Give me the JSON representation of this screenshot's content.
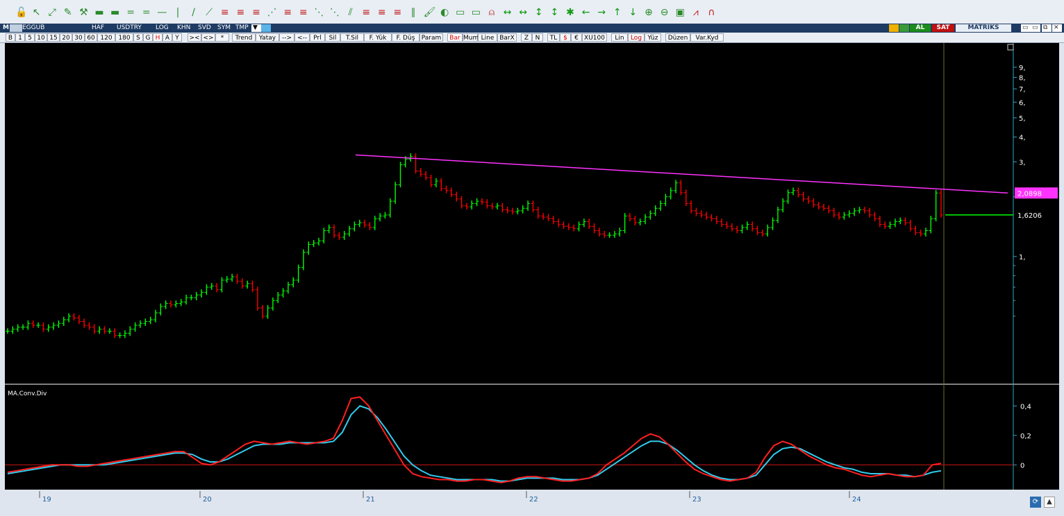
{
  "toolbar": {
    "icons": [
      "lock-icon",
      "cursor-icon",
      "resize-icon",
      "pencil-icon",
      "tools-icon",
      "ruler-icon",
      "ruler-icon",
      "equals-icon",
      "parallel-icon",
      "hline-icon",
      "vline-icon",
      "trendline-icon",
      "ray-icon",
      "fibo-icon",
      "fibo-icon",
      "fibo-icon",
      "fan-icon",
      "fibo-icon",
      "fibo-icon",
      "gann-icon",
      "gann-icon",
      "channel-icon",
      "fibo-icon",
      "fibo-icon",
      "fibo-icon",
      "lines-icon",
      "brush-icon",
      "paint-icon",
      "note-icon",
      "note-icon",
      "bell-icon",
      "arrows-h-icon",
      "arrows-h-icon",
      "arrows-v-icon",
      "arrows-v-icon",
      "star-icon",
      "arrow-left-icon",
      "arrow-right-icon",
      "arrow-up-icon",
      "arrow-down-icon",
      "zoom-in-icon",
      "zoom-out-icon",
      "box-icon",
      "chart-icon",
      "arch-icon"
    ]
  },
  "symbar": {
    "m": "M",
    "symbol": "EGGUB",
    "period": "HAF",
    "currency": "USDTRY",
    "log": "LOG",
    "khn": "KHN",
    "svd": "SVD",
    "sym": "SYM",
    "tmp": "TMP",
    "al": "AL",
    "sat": "SAT",
    "brand": "MATRIKS"
  },
  "periods": [
    "B",
    "1",
    "5",
    "10",
    "15",
    "20",
    "30",
    "60",
    "120",
    "180",
    "S",
    "G",
    "H",
    "A",
    "Y"
  ],
  "nav_buttons": [
    ">< ",
    "<>",
    "*"
  ],
  "tools": [
    "Trend",
    "Yatay",
    "-->",
    "<--",
    "Prl",
    "Sil",
    "T.Sil",
    "F. Yük",
    "F. Düş",
    "Param"
  ],
  "styles": [
    "Bar",
    "Mum",
    "Line",
    "BarX"
  ],
  "misc": [
    "Z",
    "N",
    "TL",
    "$",
    "€",
    "XU100",
    "Lin",
    "Log",
    "Yüz",
    "Düzen",
    "Var.Kyd"
  ],
  "chart_data": [
    {
      "type": "bar",
      "title": "EGGUB",
      "scale": "log",
      "y_ticks": [
        "9,",
        "8,",
        "7,",
        "6,",
        "5,",
        "4,",
        "3,",
        "1,"
      ],
      "x_ticks": [
        "19",
        "20",
        "21",
        "22",
        "23",
        "24"
      ],
      "last_price_label": "1,6206",
      "trendline_label": "2,0898",
      "colors": {
        "up": "#00ff00",
        "down": "#ff0000",
        "trendline": "#ff33ff",
        "lastline": "#00ff00"
      },
      "price_series": [
        0.42,
        0.43,
        0.44,
        0.44,
        0.46,
        0.45,
        0.45,
        0.43,
        0.44,
        0.45,
        0.46,
        0.48,
        0.5,
        0.49,
        0.47,
        0.45,
        0.44,
        0.42,
        0.43,
        0.42,
        0.42,
        0.4,
        0.4,
        0.41,
        0.43,
        0.45,
        0.46,
        0.47,
        0.48,
        0.52,
        0.56,
        0.58,
        0.57,
        0.58,
        0.59,
        0.62,
        0.62,
        0.64,
        0.66,
        0.7,
        0.71,
        0.68,
        0.76,
        0.77,
        0.79,
        0.75,
        0.71,
        0.73,
        0.68,
        0.55,
        0.5,
        0.55,
        0.6,
        0.64,
        0.67,
        0.72,
        0.76,
        0.88,
        1.05,
        1.15,
        1.17,
        1.2,
        1.35,
        1.4,
        1.28,
        1.25,
        1.3,
        1.38,
        1.45,
        1.48,
        1.44,
        1.4,
        1.55,
        1.6,
        1.62,
        1.9,
        2.3,
        2.9,
        3.1,
        3.2,
        2.7,
        2.6,
        2.5,
        2.3,
        2.4,
        2.2,
        2.15,
        2.05,
        1.95,
        1.8,
        1.78,
        1.85,
        1.9,
        1.88,
        1.8,
        1.78,
        1.8,
        1.72,
        1.7,
        1.68,
        1.7,
        1.75,
        1.85,
        1.72,
        1.6,
        1.58,
        1.55,
        1.5,
        1.45,
        1.42,
        1.4,
        1.38,
        1.45,
        1.5,
        1.42,
        1.35,
        1.3,
        1.28,
        1.28,
        1.3,
        1.35,
        1.6,
        1.55,
        1.48,
        1.5,
        1.58,
        1.65,
        1.75,
        1.85,
        2.0,
        2.15,
        2.35,
        2.1,
        1.85,
        1.7,
        1.65,
        1.62,
        1.58,
        1.55,
        1.5,
        1.45,
        1.42,
        1.38,
        1.35,
        1.4,
        1.45,
        1.38,
        1.32,
        1.3,
        1.4,
        1.52,
        1.72,
        1.9,
        2.1,
        2.15,
        2.05,
        1.95,
        1.9,
        1.82,
        1.78,
        1.75,
        1.7,
        1.62,
        1.58,
        1.62,
        1.65,
        1.7,
        1.72,
        1.7,
        1.62,
        1.55,
        1.45,
        1.42,
        1.45,
        1.5,
        1.52,
        1.48,
        1.38,
        1.32,
        1.3,
        1.35,
        1.55,
        2.09,
        1.62
      ],
      "trendline": {
        "start_value": 3.25,
        "end_value": 2.0898
      },
      "indicator": {
        "name": "MA.Conv.Div",
        "y_ticks": [
          "0,4",
          "0,2",
          "0"
        ],
        "colors": {
          "macd": "#ff2020",
          "signal": "#33ccee",
          "zero": "#aa1010"
        },
        "macd": [
          -0.05,
          -0.04,
          -0.03,
          -0.02,
          -0.01,
          0,
          0,
          0,
          -0.01,
          -0.01,
          0,
          0.01,
          0.02,
          0.03,
          0.04,
          0.05,
          0.06,
          0.07,
          0.08,
          0.09,
          0.09,
          0.05,
          0.01,
          0,
          0.02,
          0.06,
          0.1,
          0.14,
          0.16,
          0.15,
          0.14,
          0.15,
          0.16,
          0.15,
          0.14,
          0.15,
          0.16,
          0.18,
          0.3,
          0.45,
          0.46,
          0.4,
          0.3,
          0.2,
          0.1,
          0,
          -0.06,
          -0.08,
          -0.09,
          -0.1,
          -0.1,
          -0.11,
          -0.11,
          -0.1,
          -0.1,
          -0.11,
          -0.12,
          -0.11,
          -0.09,
          -0.08,
          -0.08,
          -0.09,
          -0.1,
          -0.11,
          -0.11,
          -0.1,
          -0.09,
          -0.06,
          0,
          0.04,
          0.08,
          0.13,
          0.18,
          0.21,
          0.19,
          0.14,
          0.08,
          0.02,
          -0.03,
          -0.06,
          -0.08,
          -0.1,
          -0.11,
          -0.1,
          -0.09,
          -0.05,
          0.05,
          0.13,
          0.16,
          0.14,
          0.1,
          0.06,
          0.03,
          0,
          -0.02,
          -0.03,
          -0.05,
          -0.07,
          -0.08,
          -0.07,
          -0.06,
          -0.07,
          -0.08,
          -0.08,
          -0.07,
          0,
          0.01
        ],
        "signal": [
          -0.06,
          -0.05,
          -0.04,
          -0.03,
          -0.02,
          -0.01,
          0,
          0,
          0,
          0,
          0,
          0,
          0.01,
          0.02,
          0.03,
          0.04,
          0.05,
          0.06,
          0.07,
          0.08,
          0.08,
          0.07,
          0.04,
          0.02,
          0.02,
          0.04,
          0.07,
          0.1,
          0.13,
          0.14,
          0.14,
          0.14,
          0.15,
          0.15,
          0.15,
          0.15,
          0.15,
          0.16,
          0.22,
          0.34,
          0.4,
          0.38,
          0.32,
          0.24,
          0.15,
          0.06,
          0,
          -0.04,
          -0.07,
          -0.08,
          -0.09,
          -0.1,
          -0.1,
          -0.1,
          -0.1,
          -0.1,
          -0.11,
          -0.11,
          -0.1,
          -0.09,
          -0.09,
          -0.09,
          -0.09,
          -0.1,
          -0.1,
          -0.1,
          -0.09,
          -0.07,
          -0.03,
          0.01,
          0.05,
          0.09,
          0.13,
          0.16,
          0.16,
          0.14,
          0.1,
          0.05,
          0,
          -0.04,
          -0.07,
          -0.09,
          -0.1,
          -0.1,
          -0.09,
          -0.07,
          0,
          0.07,
          0.11,
          0.12,
          0.11,
          0.08,
          0.05,
          0.02,
          0,
          -0.02,
          -0.03,
          -0.05,
          -0.06,
          -0.06,
          -0.06,
          -0.07,
          -0.07,
          -0.08,
          -0.07,
          -0.05,
          -0.04
        ]
      }
    }
  ]
}
